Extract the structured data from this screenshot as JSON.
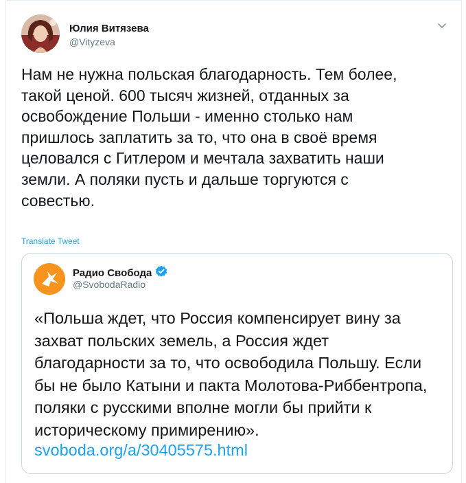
{
  "tweet": {
    "author": {
      "name": "Юлия Витязева",
      "handle": "@Vityzeva",
      "avatar_icon": "avatar-photo-icon"
    },
    "menu_icon": "chevron-down-icon",
    "text": "Нам не нужна польская благодарность. Тем более,\nтакой ценой. 600 тысяч жизней, отданных за\nосвобождение Польши - именно столько нам\nпришлось заплатить за то, что она в своё время\nцеловался с Гитлером и мечтала захватить наши\nземли. А поляки пусть и дальше торгуются с\nсовестью.",
    "translate_label": "Translate Tweet"
  },
  "quote": {
    "author": {
      "name": "Радио Свобода",
      "handle": "@SvobodaRadio",
      "verified_icon": "verified-badge-icon",
      "avatar_icon": "radio-svoboda-logo-icon"
    },
    "text": "«Польша ждет, что Россия компенсирует вину за\nзахват польских земель, а Россия ждет\nблагодарности за то, что освободила Польшу. Если\nбы не было Катыни и пакта Молотова-Риббентропа,\nполяки с русскими вполне могли бы прийти к\nисторическому примирению».",
    "link": "svoboda.org/a/30405575.html"
  },
  "colors": {
    "link": "#1da1f2",
    "secondary_text": "#657786",
    "border": "#ccd6dd",
    "svoboda_orange": "#f7941d"
  }
}
